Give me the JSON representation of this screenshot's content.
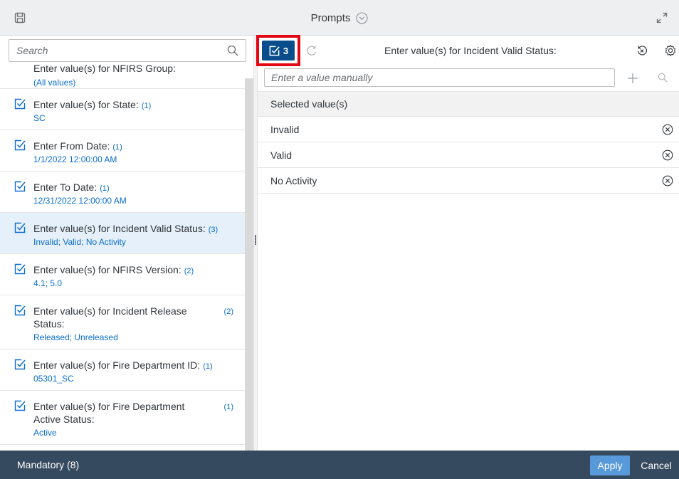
{
  "window": {
    "title": "Prompts",
    "icons": {
      "save": "save-icon",
      "dropdown": "circle-chevron-down-icon",
      "expand": "expand-icon"
    }
  },
  "left_panel": {
    "search": {
      "placeholder": "Search"
    },
    "prompts": [
      {
        "title": "Enter value(s) for NFIRS Group:",
        "count": "",
        "value": "(All values)",
        "checked": false
      },
      {
        "title": "Enter value(s) for State:",
        "count": "(1)",
        "value": "SC",
        "checked": true
      },
      {
        "title": "Enter From Date:",
        "count": "(1)",
        "value": "1/1/2022 12:00:00 AM",
        "checked": true
      },
      {
        "title": "Enter To Date:",
        "count": "(1)",
        "value": "12/31/2022 12:00:00 AM",
        "checked": true
      },
      {
        "title": "Enter value(s) for Incident Valid Status:",
        "count": "(3)",
        "value": "Invalid; Valid; No Activity",
        "checked": true,
        "active": true
      },
      {
        "title": "Enter value(s) for NFIRS Version:",
        "count": "(2)",
        "value": "4.1; 5.0",
        "checked": true
      },
      {
        "title_line1": "Enter value(s) for Incident Release",
        "title_line2": "Status:",
        "count": "(2)",
        "value": "Released; Unreleased",
        "checked": true
      },
      {
        "title": "Enter value(s) for Fire Department ID:",
        "count": "(1)",
        "value": "05301_SC",
        "checked": true
      },
      {
        "title_line1": "Enter value(s) for Fire Department",
        "title_line2": "Active Status:",
        "count": "(1)",
        "value": "Active",
        "checked": true
      }
    ]
  },
  "right_panel": {
    "selected_count": "3",
    "heading": "Enter value(s) for Incident Valid Status:",
    "manual_input": {
      "placeholder": "Enter a value manually"
    },
    "selected_header": "Selected value(s)",
    "selected_values": [
      "Invalid",
      "Valid",
      "No Activity"
    ]
  },
  "footer": {
    "mandatory": "Mandatory (8)",
    "apply": "Apply",
    "cancel": "Cancel"
  },
  "colors": {
    "accent": "#0a6ed1",
    "selected_button": "#0a4d8c",
    "highlight": "#e30613",
    "footer": "#354a5f",
    "apply": "#5899da",
    "active_row": "#e5f0fa"
  }
}
